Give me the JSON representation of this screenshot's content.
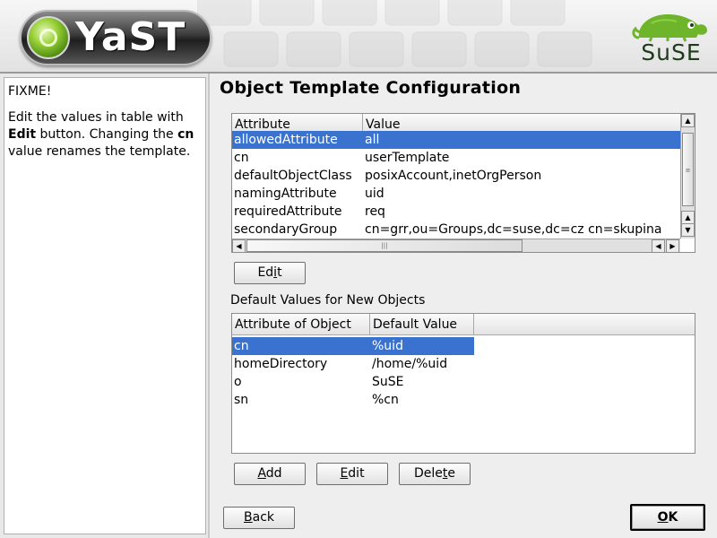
{
  "header": {
    "app_logo_text": "YaST",
    "vendor_logo_text": "SuSE"
  },
  "help": {
    "heading": "FIXME!",
    "text_1": "Edit the values in table with ",
    "bold_1": "Edit",
    "text_2": " button. Changing the ",
    "bold_2": "cn",
    "text_3": " value renames the template."
  },
  "main": {
    "title": "Object Template Configuration",
    "attributes_table": {
      "columns": [
        "Attribute",
        "Value"
      ],
      "rows": [
        {
          "attribute": "allowedAttribute",
          "value": "all",
          "selected": true
        },
        {
          "attribute": "cn",
          "value": "userTemplate",
          "selected": false
        },
        {
          "attribute": "defaultObjectClass",
          "value": "posixAccount,inetOrgPerson",
          "selected": false
        },
        {
          "attribute": "namingAttribute",
          "value": "uid",
          "selected": false
        },
        {
          "attribute": "requiredAttribute",
          "value": "req",
          "selected": false
        },
        {
          "attribute": "secondaryGroup",
          "value": "cn=grr,ou=Groups,dc=suse,dc=cz cn=skupina",
          "selected": false
        }
      ]
    },
    "edit_button": {
      "pre": "Ed",
      "mnemonic": "i",
      "post": "t"
    },
    "defaults_label": "Default Values for New Objects",
    "defaults_table": {
      "columns": [
        "Attribute of Object",
        "Default Value"
      ],
      "rows": [
        {
          "attribute": "cn",
          "value": "%uid",
          "selected": true
        },
        {
          "attribute": "homeDirectory",
          "value": "/home/%uid",
          "selected": false
        },
        {
          "attribute": "o",
          "value": "SuSE",
          "selected": false
        },
        {
          "attribute": "sn",
          "value": "%cn",
          "selected": false
        }
      ]
    },
    "add_button": {
      "pre": "",
      "mnemonic": "A",
      "post": "dd"
    },
    "edit2_button": {
      "pre": "",
      "mnemonic": "E",
      "post": "dit"
    },
    "delete_button": {
      "pre": "Dele",
      "mnemonic": "t",
      "post": "e"
    }
  },
  "footer": {
    "back_button": {
      "pre": "",
      "mnemonic": "B",
      "post": "ack"
    },
    "ok_button": {
      "pre": "",
      "mnemonic": "O",
      "post": "K"
    }
  },
  "colors": {
    "selection": "#3a72d0",
    "logo_green": "#6fb52c"
  },
  "icons": {
    "scroll_up": "triangle-up",
    "scroll_down": "triangle-down",
    "scroll_left": "triangle-left",
    "scroll_right": "triangle-right"
  }
}
